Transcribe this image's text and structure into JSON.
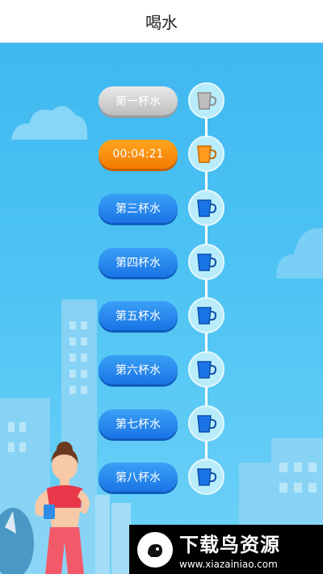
{
  "header": {
    "title": "喝水"
  },
  "cups": [
    {
      "label": "第一杯水",
      "state": "done",
      "cup_color": "#bdbdbd"
    },
    {
      "label": "00:04:21",
      "state": "active",
      "cup_color": "#ff9a1f"
    },
    {
      "label": "第三杯水",
      "state": "pending",
      "cup_color": "#1a74e6"
    },
    {
      "label": "第四杯水",
      "state": "pending",
      "cup_color": "#1a74e6"
    },
    {
      "label": "第五杯水",
      "state": "pending",
      "cup_color": "#1a74e6"
    },
    {
      "label": "第六杯水",
      "state": "pending",
      "cup_color": "#1a74e6"
    },
    {
      "label": "第七杯水",
      "state": "pending",
      "cup_color": "#1a74e6"
    },
    {
      "label": "第八杯水",
      "state": "pending",
      "cup_color": "#1a74e6"
    }
  ],
  "watermark": {
    "text": "下载鸟资源",
    "url": "www.xiazainiao.com"
  },
  "colors": {
    "sky": "#3fb8f0",
    "active": "#f47b00",
    "pending": "#1a74e6",
    "done": "#bdbdbd"
  }
}
